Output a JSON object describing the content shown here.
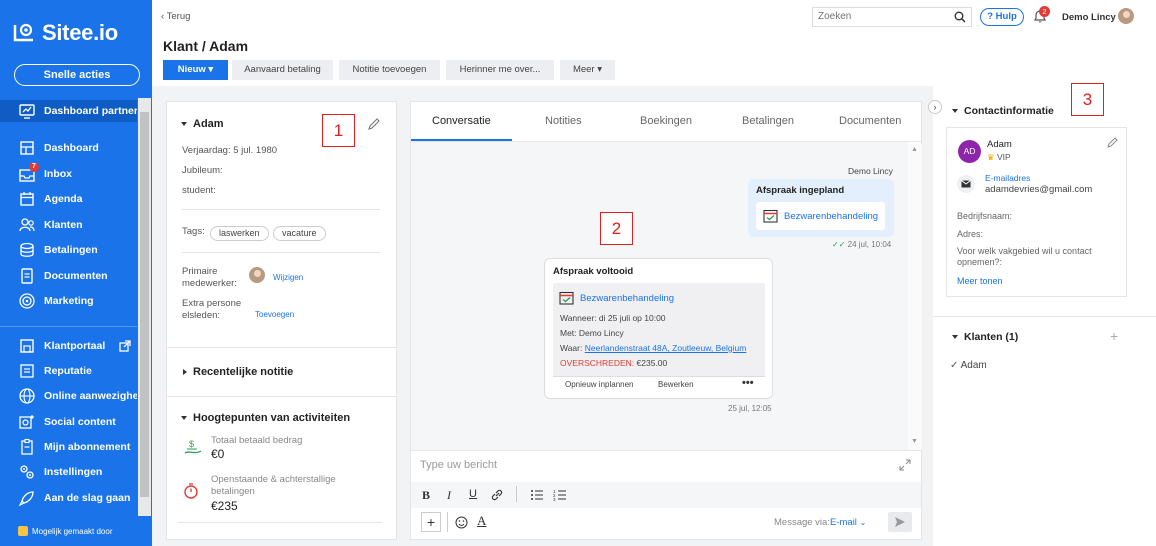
{
  "brand": {
    "name": "Sitee.io",
    "quick_actions": "Snelle acties",
    "footer": "Mogelijk gemaakt door"
  },
  "sidebar": {
    "items": [
      {
        "label": "Dashboard partner",
        "icon": "partner-dashboard-icon",
        "active": true
      },
      {
        "label": "Dashboard",
        "icon": "dashboard-icon"
      },
      {
        "label": "Inbox",
        "icon": "inbox-icon",
        "badge": "7"
      },
      {
        "label": "Agenda",
        "icon": "calendar-icon"
      },
      {
        "label": "Klanten",
        "icon": "users-icon"
      },
      {
        "label": "Betalingen",
        "icon": "payments-icon"
      },
      {
        "label": "Documenten",
        "icon": "document-icon"
      },
      {
        "label": "Marketing",
        "icon": "target-icon"
      },
      {
        "label": "Klantportaal",
        "icon": "portal-icon"
      },
      {
        "label": "Reputatie",
        "icon": "reputation-icon"
      },
      {
        "label": "Online aanwezigheid",
        "icon": "globe-icon"
      },
      {
        "label": "Social content",
        "icon": "social-icon"
      },
      {
        "label": "Mijn abonnement",
        "icon": "subscription-icon"
      },
      {
        "label": "Instellingen",
        "icon": "settings-icon"
      },
      {
        "label": "Aan de slag gaan",
        "icon": "rocket-icon"
      }
    ]
  },
  "topbar": {
    "back": "Terug",
    "search_placeholder": "Zoeken",
    "help": "Hulp",
    "notif_count": "2",
    "user": "Demo Lincy"
  },
  "header": {
    "title": "Klant / Adam",
    "new": "Nieuw",
    "actions": [
      "Aanvaard betaling",
      "Notitie toevoegen",
      "Herinner me over...",
      "Meer"
    ]
  },
  "left": {
    "name": "Adam",
    "birthday": "Verjaardag: 5 jul. 1980",
    "jubileum": "Jubileum:",
    "student": "student:",
    "tags_label": "Tags:",
    "tags": [
      "laswerken",
      "vacature"
    ],
    "primary_label": "Primaire medewerker:",
    "change": "Wijzigen",
    "extra_label": "Extra personeelsleden:",
    "add": "Toevoegen",
    "recent_note": "Recentelijke notitie",
    "highlights": "Hoogtepunten van activiteiten",
    "paid_label": "Totaal betaald bedrag",
    "paid_value": "€0",
    "due_label": "Openstaande & achterstallige betalingen",
    "due_value": "€235"
  },
  "center": {
    "tabs": [
      "Conversatie",
      "Notities",
      "Boekingen",
      "Betalingen",
      "Documenten"
    ],
    "sender": "Demo Lincy",
    "msg1": {
      "title": "Afspraak ingepland",
      "service": "Bezwarenbehandeling",
      "time": "24 jul, 10:04"
    },
    "msg2": {
      "title": "Afspraak voltooid",
      "service": "Bezwarenbehandeling",
      "when": "Wanneer:  di 25 juli op 10:00",
      "with": "Met:  Demo Lincy",
      "where_label": "Waar:",
      "where": "Neerlandenstraat 48A, Zoutleeuw, Belgium",
      "overdue_label": "OVERSCHREDEN:",
      "overdue_value": "€235.00",
      "reschedule": "Opnieuw inplannen",
      "edit": "Bewerken",
      "time": "25 jul, 12:05"
    },
    "composer_placeholder": "Type uw bericht",
    "via_label": "Message via:",
    "via_value": "E-mail"
  },
  "right": {
    "contact_title": "Contactinformatie",
    "initials": "AD",
    "name": "Adam",
    "vip": "VIP",
    "email_label": "E-mailadres",
    "email": "adamdevries@gmail.com",
    "company": "Bedrijfsnaam:",
    "address": "Adres:",
    "question": "Voor welk vakgebied wil u contact opnemen?:",
    "more": "Meer tonen",
    "clients": "Klanten (1)",
    "client_item": "Adam"
  },
  "callouts": [
    "1",
    "2",
    "3"
  ],
  "colors": {
    "accent": "#1a73e8",
    "danger": "#e53935",
    "avatar": "#8e24aa",
    "success": "#2e9e5b"
  }
}
